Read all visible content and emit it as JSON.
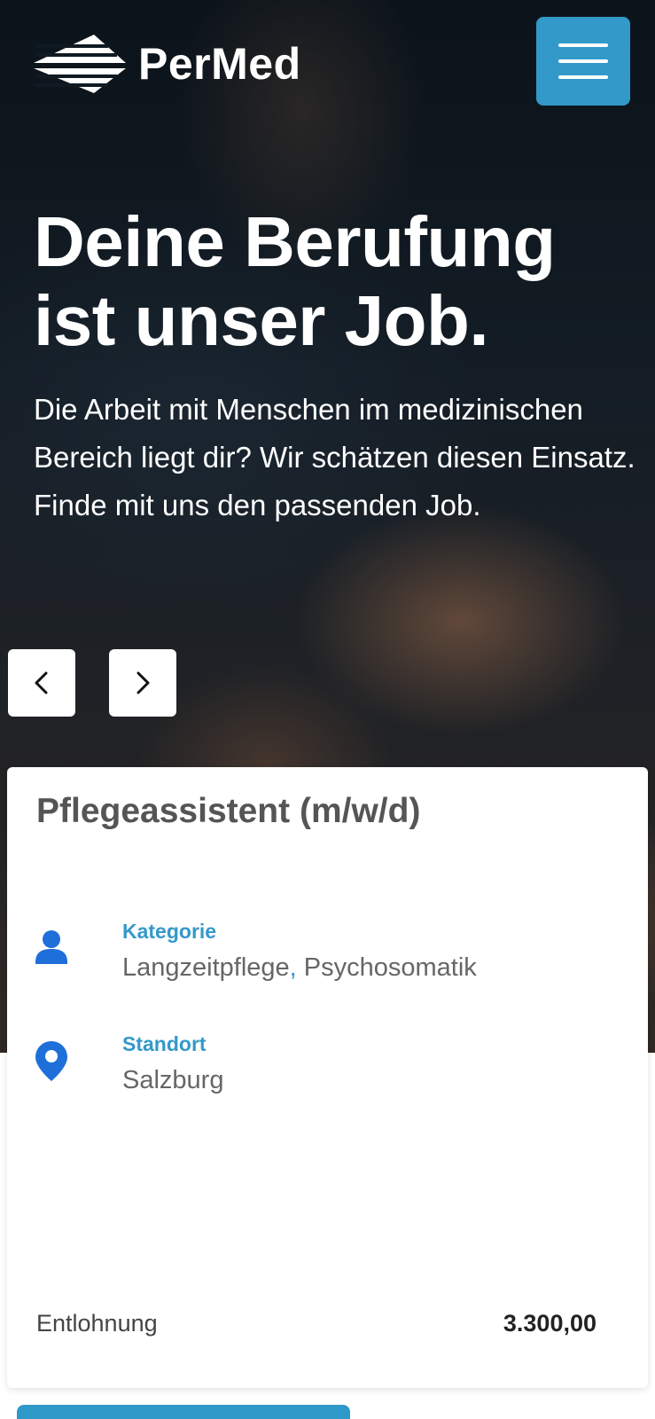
{
  "header": {
    "brand": "PerMed",
    "menu_icon": "hamburger-menu-icon",
    "accent_color": "#3399c9"
  },
  "hero": {
    "headline_line1": "Deine Berufung",
    "headline_line2": "ist unser Job.",
    "subline": "Die Arbeit mit Menschen im medizinischen Bereich liegt dir? Wir schätzen diesen Einsatz. Finde mit uns den passenden Job.",
    "prev_icon": "chevron-left-icon",
    "next_icon": "chevron-right-icon"
  },
  "job": {
    "title": "Pflegeassistent (m/w/d)",
    "category_label": "Kategorie",
    "category_1": "Langzeitpflege",
    "category_separator": ",",
    "category_2": "Psychosomatik",
    "location_label": "Standort",
    "location_value": "Salzburg",
    "pay_label": "Entlohnung",
    "pay_value": "3.300,00",
    "category_icon": "person-icon",
    "location_icon": "map-pin-icon",
    "icon_color": "#1e6fd9"
  }
}
